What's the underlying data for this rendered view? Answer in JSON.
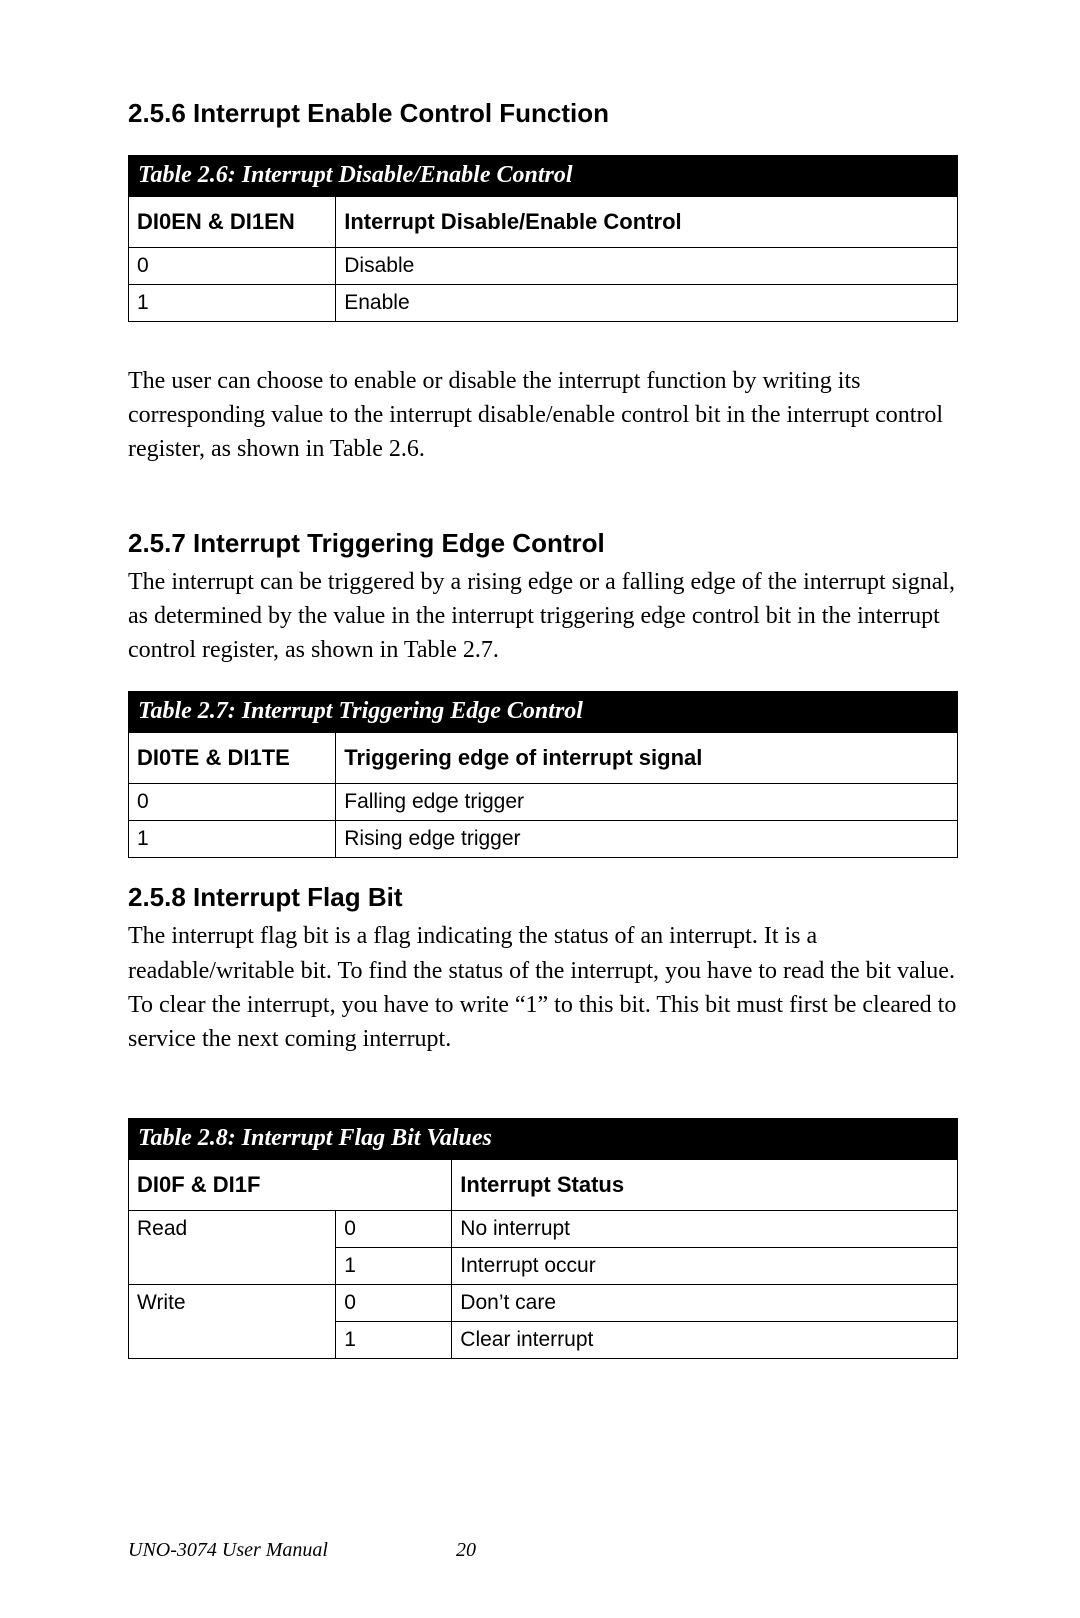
{
  "section_256": {
    "heading": "2.5.6 Interrupt Enable Control Function",
    "text": "The user can choose to enable or disable the interrupt function by writing its corresponding value to the interrupt disable/enable control bit in the interrupt control register, as shown in Table 2.6."
  },
  "table26": {
    "caption": "Table 2.6: Interrupt Disable/Enable Control",
    "header_col1": "DI0EN & DI1EN",
    "header_col2": "Interrupt Disable/Enable Control",
    "rows": [
      {
        "c1": "0",
        "c2": "Disable"
      },
      {
        "c1": "1",
        "c2": "Enable"
      }
    ]
  },
  "section_257": {
    "heading": "2.5.7 Interrupt Triggering Edge Control",
    "text": "The interrupt can be triggered by a rising edge or a falling edge of the interrupt signal, as determined by the value in the interrupt triggering edge control bit in the interrupt control register, as shown in Table 2.7."
  },
  "table27": {
    "caption": "Table 2.7: Interrupt Triggering Edge Control",
    "header_col1": "DI0TE & DI1TE",
    "header_col2": "Triggering edge of interrupt signal",
    "rows": [
      {
        "c1": "0",
        "c2": "Falling edge trigger"
      },
      {
        "c1": "1",
        "c2": "Rising edge trigger"
      }
    ]
  },
  "section_258": {
    "heading": "2.5.8 Interrupt Flag Bit",
    "text": "The interrupt flag bit is a flag indicating the status of an interrupt. It is a readable/writable bit. To find the status of the interrupt, you have to read the bit value. To clear the interrupt, you have to write “1” to this bit. This bit must first be cleared to service the next coming interrupt."
  },
  "table28": {
    "caption": "Table 2.8: Interrupt Flag Bit Values",
    "header_col1": "DI0F & DI1F",
    "header_col2": "Interrupt Status",
    "rows": [
      {
        "c1": "Read",
        "c2": "0",
        "c3": "No interrupt"
      },
      {
        "c1": "",
        "c2": "1",
        "c3": "Interrupt occur"
      },
      {
        "c1": "Write",
        "c2": "0",
        "c3": "Don’t care"
      },
      {
        "c1": "",
        "c2": "1",
        "c3": "Clear interrupt"
      }
    ]
  },
  "footer": {
    "title": "UNO-3074 User Manual",
    "page": "20"
  }
}
